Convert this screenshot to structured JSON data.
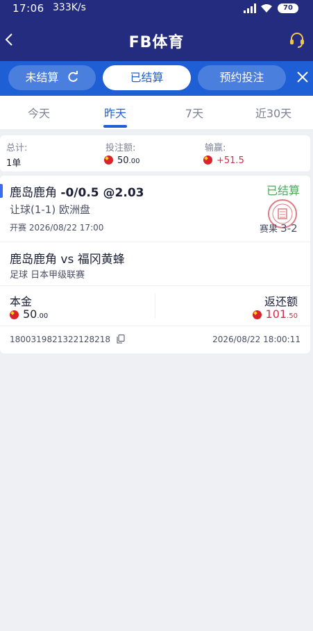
{
  "status_bar": {
    "time": "17:06",
    "speed": "333K/s",
    "battery": "70"
  },
  "header": {
    "title": "FB体育"
  },
  "bet_tabs": [
    {
      "label": "未结算"
    },
    {
      "label": "已结算"
    },
    {
      "label": "预约投注"
    }
  ],
  "periods": [
    {
      "label": "今天"
    },
    {
      "label": "昨天"
    },
    {
      "label": "7天"
    },
    {
      "label": "近30天"
    }
  ],
  "summary": {
    "total_label": "总计:",
    "total_value": "1单",
    "stake_label": "投注额:",
    "stake_int": "50",
    "stake_dec": ".00",
    "pl_label": "输赢:",
    "pl_value": "+51.5"
  },
  "bet": {
    "selection": "鹿岛鹿角",
    "handicap": "-0/0.5 @2.03",
    "status": "已结算",
    "market": "让球(1-1) 欧洲盘",
    "kickoff": "开赛 2026/08/22 17:00",
    "result_label": "赛果",
    "result_score": "3-2",
    "match": "鹿岛鹿角 vs 福冈黄蜂",
    "league": "足球  日本甲级联赛",
    "principal_label": "本金",
    "principal_int": "50",
    "principal_dec": ".00",
    "return_label": "返还额",
    "return_int": "101",
    "return_dec": ".50",
    "order_id": "1800319821322128218",
    "settled_time": "2026/08/22 18:00:11"
  },
  "colors": {
    "header_bg": "#232c7e",
    "tab_bar_bg": "#1f5fd6",
    "accent_blue": "#1f5fd6",
    "settled_green": "#49a85b",
    "profit_red": "#e0264a"
  }
}
